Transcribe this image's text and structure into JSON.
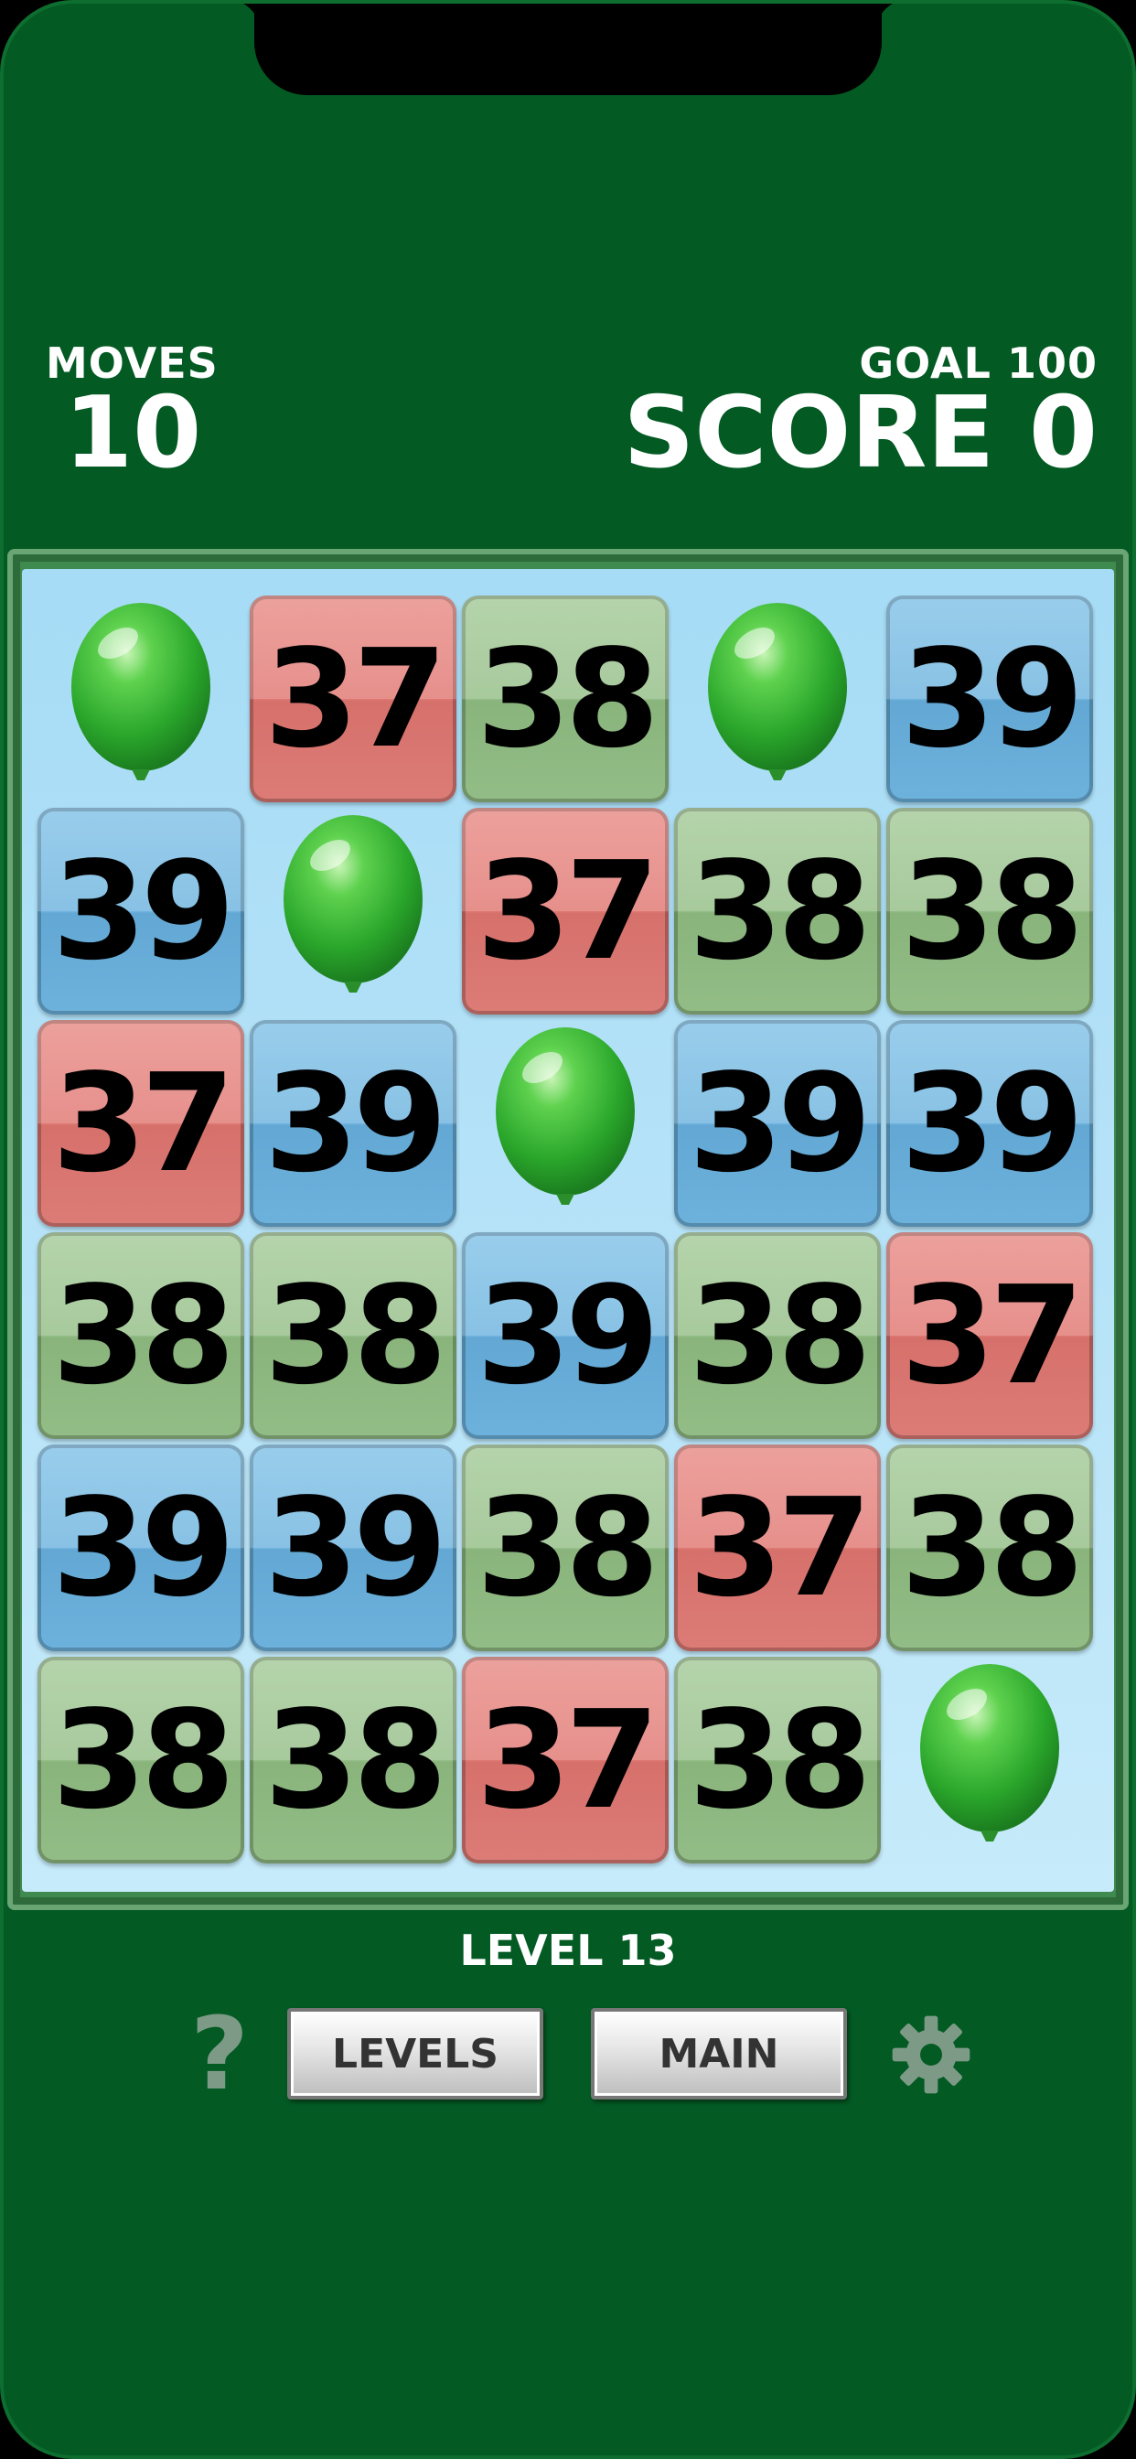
{
  "hud": {
    "moves_label": "MOVES",
    "moves_value": "10",
    "goal_label": "GOAL 100",
    "score_label": "SCORE 0"
  },
  "board": {
    "rows": [
      [
        "balloon",
        "37",
        "38",
        "balloon",
        "39"
      ],
      [
        "39",
        "balloon",
        "37",
        "38",
        "38"
      ],
      [
        "37",
        "39",
        "balloon",
        "39",
        "39"
      ],
      [
        "38",
        "38",
        "39",
        "38",
        "37"
      ],
      [
        "39",
        "39",
        "38",
        "37",
        "38"
      ],
      [
        "38",
        "38",
        "37",
        "38",
        "balloon"
      ]
    ],
    "tile_colors": {
      "37": "red",
      "38": "green",
      "39": "blue"
    },
    "balloon_icon": "green-balloon-icon"
  },
  "footer": {
    "level_text": "LEVEL 13",
    "help_icon": "?",
    "levels_button": "LEVELS",
    "main_button": "MAIN",
    "settings_icon": "gear-icon"
  },
  "colors": {
    "background": "#035a23",
    "board": "#b3e0f7",
    "tile_red": "#e27b76",
    "tile_green": "#97c08a",
    "tile_blue": "#72b6e0",
    "balloon": "#3cb93c"
  }
}
